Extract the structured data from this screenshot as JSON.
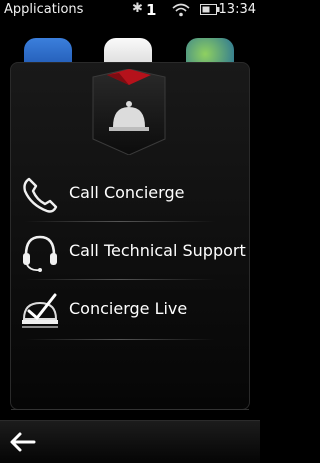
{
  "status_bar": {
    "title": "Applications",
    "bluetooth_glyph": "✱",
    "notification_count": "1",
    "time": "13:34"
  },
  "background_apps": [
    "store-icon",
    "maps-icon",
    "earth-icon"
  ],
  "popup": {
    "header_icon": "concierge-bell-icon",
    "items": [
      {
        "label": "Call Concierge",
        "icon": "phone-handset-icon"
      },
      {
        "label": "Call Technical Support",
        "icon": "headset-icon"
      },
      {
        "label": "Concierge Live",
        "icon": "concierge-live-icon"
      }
    ]
  },
  "toolbar": {
    "back_icon": "back-arrow-icon"
  },
  "colors": {
    "background": "#000000",
    "header_red": "#b5121b",
    "text": "#ffffff"
  }
}
